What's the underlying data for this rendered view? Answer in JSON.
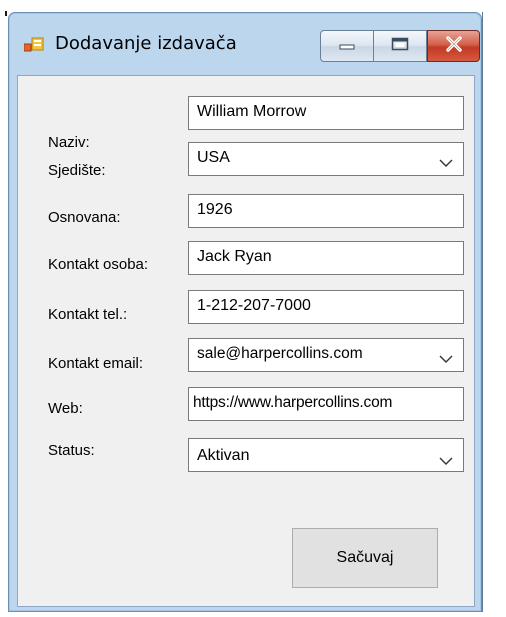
{
  "window": {
    "title": "Dodavanje izdavača",
    "icon": "form-icon",
    "controls": [
      "minimize-icon",
      "maximize-icon",
      "close-icon"
    ]
  },
  "form": {
    "naziv": {
      "label": "Naziv:",
      "value": "William Morrow"
    },
    "sjediste": {
      "label": "Sjedište:",
      "value": "USA"
    },
    "osnovana": {
      "label": "Osnovana:",
      "value": "1926"
    },
    "kontakt_osoba": {
      "label": "Kontakt osoba:",
      "value": "Jack Ryan"
    },
    "kontakt_tel": {
      "label": "Kontakt tel.:",
      "value": "1-212-207-7000"
    },
    "kontakt_email": {
      "label": "Kontakt email:",
      "value": "sale@harpercollins.com"
    },
    "web": {
      "label": "Web:",
      "value": "https://www.harpercollins.com"
    },
    "status": {
      "label": "Status:",
      "value": "Aktivan"
    }
  },
  "actions": {
    "save_label": "Sačuvaj"
  },
  "colors": {
    "frame": "#bcd6ee",
    "client": "#f0f0f0",
    "close_button": "#c23a23"
  }
}
